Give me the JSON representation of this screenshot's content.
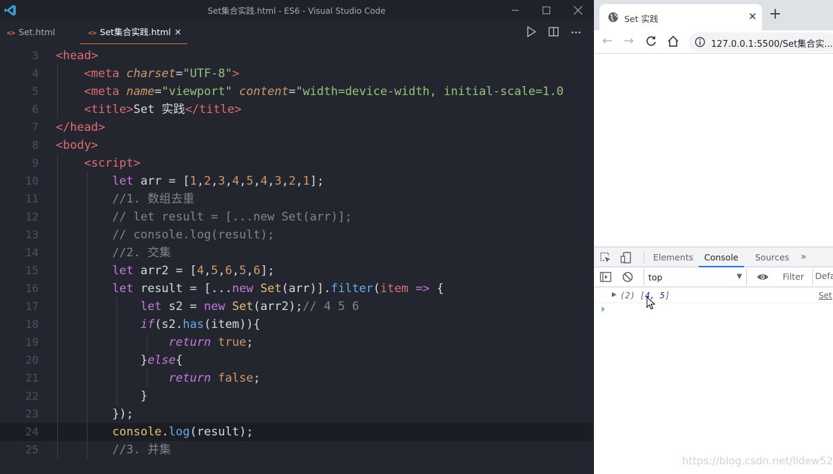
{
  "vscode": {
    "window_title": "Set集合实践.html - ES6 - Visual Studio Code",
    "tabs": [
      {
        "label": "Set.html"
      },
      {
        "label": "Set集合实践.html"
      }
    ],
    "code_lines": [
      {
        "n": "3",
        "tokens": [
          {
            "t": "<head>",
            "c": "t-tag"
          }
        ]
      },
      {
        "n": "4",
        "tokens": [
          {
            "t": "    "
          },
          {
            "t": "<meta ",
            "c": "t-tag"
          },
          {
            "t": "charset",
            "c": "t-attr"
          },
          {
            "t": "=",
            "c": "t-plain"
          },
          {
            "t": "\"UTF-8\"",
            "c": "t-str"
          },
          {
            "t": ">",
            "c": "t-tag"
          }
        ]
      },
      {
        "n": "5",
        "tokens": [
          {
            "t": "    "
          },
          {
            "t": "<meta ",
            "c": "t-tag"
          },
          {
            "t": "name",
            "c": "t-attr"
          },
          {
            "t": "=",
            "c": "t-plain"
          },
          {
            "t": "\"viewport\" ",
            "c": "t-str"
          },
          {
            "t": "content",
            "c": "t-attr"
          },
          {
            "t": "=",
            "c": "t-plain"
          },
          {
            "t": "\"width=device-width, initial-scale=1.0",
            "c": "t-str"
          }
        ]
      },
      {
        "n": "6",
        "tokens": [
          {
            "t": "    "
          },
          {
            "t": "<title>",
            "c": "t-tag"
          },
          {
            "t": "Set 实践",
            "c": "t-plain"
          },
          {
            "t": "</title>",
            "c": "t-tag"
          }
        ]
      },
      {
        "n": "7",
        "tokens": [
          {
            "t": "</head>",
            "c": "t-tag"
          }
        ]
      },
      {
        "n": "8",
        "tokens": [
          {
            "t": "<body>",
            "c": "t-tag"
          }
        ]
      },
      {
        "n": "9",
        "tokens": [
          {
            "t": "    "
          },
          {
            "t": "<script>",
            "c": "t-tag"
          }
        ]
      },
      {
        "n": "10",
        "tokens": [
          {
            "t": "        "
          },
          {
            "t": "let ",
            "c": "t-kw"
          },
          {
            "t": "arr = [",
            "c": "t-plain"
          },
          {
            "t": "1",
            "c": "t-num"
          },
          {
            "t": ",",
            "c": "t-plain"
          },
          {
            "t": "2",
            "c": "t-num"
          },
          {
            "t": ",",
            "c": "t-plain"
          },
          {
            "t": "3",
            "c": "t-num"
          },
          {
            "t": ",",
            "c": "t-plain"
          },
          {
            "t": "4",
            "c": "t-num"
          },
          {
            "t": ",",
            "c": "t-plain"
          },
          {
            "t": "5",
            "c": "t-num"
          },
          {
            "t": ",",
            "c": "t-plain"
          },
          {
            "t": "4",
            "c": "t-num"
          },
          {
            "t": ",",
            "c": "t-plain"
          },
          {
            "t": "3",
            "c": "t-num"
          },
          {
            "t": ",",
            "c": "t-plain"
          },
          {
            "t": "2",
            "c": "t-num"
          },
          {
            "t": ",",
            "c": "t-plain"
          },
          {
            "t": "1",
            "c": "t-num"
          },
          {
            "t": "];",
            "c": "t-plain"
          }
        ]
      },
      {
        "n": "11",
        "tokens": [
          {
            "t": "        "
          },
          {
            "t": "//1. 数组去重",
            "c": "t-cmt"
          }
        ]
      },
      {
        "n": "12",
        "tokens": [
          {
            "t": "        "
          },
          {
            "t": "// let result = [...new Set(arr)];",
            "c": "t-cmt"
          }
        ]
      },
      {
        "n": "13",
        "tokens": [
          {
            "t": "        "
          },
          {
            "t": "// console.log(result);",
            "c": "t-cmt"
          }
        ]
      },
      {
        "n": "14",
        "tokens": [
          {
            "t": "        "
          },
          {
            "t": "//2. 交集",
            "c": "t-cmt"
          }
        ]
      },
      {
        "n": "15",
        "tokens": [
          {
            "t": "        "
          },
          {
            "t": "let ",
            "c": "t-kw"
          },
          {
            "t": "arr2 = [",
            "c": "t-plain"
          },
          {
            "t": "4",
            "c": "t-num"
          },
          {
            "t": ",",
            "c": "t-plain"
          },
          {
            "t": "5",
            "c": "t-num"
          },
          {
            "t": ",",
            "c": "t-plain"
          },
          {
            "t": "6",
            "c": "t-num"
          },
          {
            "t": ",",
            "c": "t-plain"
          },
          {
            "t": "5",
            "c": "t-num"
          },
          {
            "t": ",",
            "c": "t-plain"
          },
          {
            "t": "6",
            "c": "t-num"
          },
          {
            "t": "];",
            "c": "t-plain"
          }
        ]
      },
      {
        "n": "16",
        "tokens": [
          {
            "t": "        "
          },
          {
            "t": "let ",
            "c": "t-kw"
          },
          {
            "t": "result = [...",
            "c": "t-plain"
          },
          {
            "t": "new ",
            "c": "t-kw"
          },
          {
            "t": "Set",
            "c": "t-cls"
          },
          {
            "t": "(arr)].",
            "c": "t-plain"
          },
          {
            "t": "filter",
            "c": "t-fn"
          },
          {
            "t": "(",
            "c": "t-plain"
          },
          {
            "t": "item",
            "c": "t-param"
          },
          {
            "t": " => ",
            "c": "t-kw"
          },
          {
            "t": "{",
            "c": "t-plain"
          }
        ]
      },
      {
        "n": "17",
        "tokens": [
          {
            "t": "            "
          },
          {
            "t": "let ",
            "c": "t-kw"
          },
          {
            "t": "s2 = ",
            "c": "t-plain"
          },
          {
            "t": "new ",
            "c": "t-kw"
          },
          {
            "t": "Set",
            "c": "t-cls"
          },
          {
            "t": "(arr2);",
            "c": "t-plain"
          },
          {
            "t": "// 4 5 6",
            "c": "t-cmt"
          }
        ]
      },
      {
        "n": "18",
        "tokens": [
          {
            "t": "            "
          },
          {
            "t": "if",
            "c": "t-kwi"
          },
          {
            "t": "(s2.",
            "c": "t-plain"
          },
          {
            "t": "has",
            "c": "t-fn"
          },
          {
            "t": "(item)){",
            "c": "t-plain"
          }
        ]
      },
      {
        "n": "19",
        "tokens": [
          {
            "t": "                "
          },
          {
            "t": "return ",
            "c": "t-kwi"
          },
          {
            "t": "true",
            "c": "t-bool"
          },
          {
            "t": ";",
            "c": "t-plain"
          }
        ]
      },
      {
        "n": "20",
        "tokens": [
          {
            "t": "            "
          },
          {
            "t": "}",
            "c": "t-plain"
          },
          {
            "t": "else",
            "c": "t-kwi"
          },
          {
            "t": "{",
            "c": "t-plain"
          }
        ]
      },
      {
        "n": "21",
        "tokens": [
          {
            "t": "                "
          },
          {
            "t": "return ",
            "c": "t-kwi"
          },
          {
            "t": "false",
            "c": "t-bool"
          },
          {
            "t": ";",
            "c": "t-plain"
          }
        ]
      },
      {
        "n": "22",
        "tokens": [
          {
            "t": "            "
          },
          {
            "t": "}",
            "c": "t-plain"
          }
        ]
      },
      {
        "n": "23",
        "tokens": [
          {
            "t": "        "
          },
          {
            "t": "});",
            "c": "t-plain"
          }
        ]
      },
      {
        "n": "24",
        "tokens": [
          {
            "t": "        "
          },
          {
            "t": "console",
            "c": "t-cls"
          },
          {
            "t": ".",
            "c": "t-plain"
          },
          {
            "t": "log",
            "c": "t-fn"
          },
          {
            "t": "(result);",
            "c": "t-plain"
          }
        ]
      },
      {
        "n": "25",
        "tokens": [
          {
            "t": "        "
          },
          {
            "t": "//3. 并集",
            "c": "t-cmt"
          }
        ]
      }
    ],
    "active_line": "24"
  },
  "browser": {
    "tab_title": "Set 实践",
    "url": "127.0.0.1:5500/Set集合实...",
    "devtools_tabs": [
      "Elements",
      "Console",
      "Sources"
    ],
    "active_devtools_tab": "Console",
    "context": "top",
    "filter_placeholder": "Filter",
    "default_levels": "Defa",
    "console_output": {
      "prefix": "(2) [",
      "values": "4, 5",
      "suffix": "]",
      "source": "Set"
    },
    "prompt": "›"
  },
  "watermark": "https://blog.csdn.net/lldew521",
  "icons": [
    "vscode-logo-icon",
    "html-file-icon",
    "run-icon",
    "split-editor-icon",
    "more-icon",
    "globe-icon",
    "close-icon",
    "new-tab-icon",
    "back-icon",
    "forward-icon",
    "reload-icon",
    "home-icon",
    "info-icon",
    "inspect-icon",
    "device-toolbar-icon",
    "chevron-more-icon",
    "sidebar-toggle-icon",
    "clear-console-icon",
    "eye-icon",
    "mouse-cursor-icon"
  ]
}
